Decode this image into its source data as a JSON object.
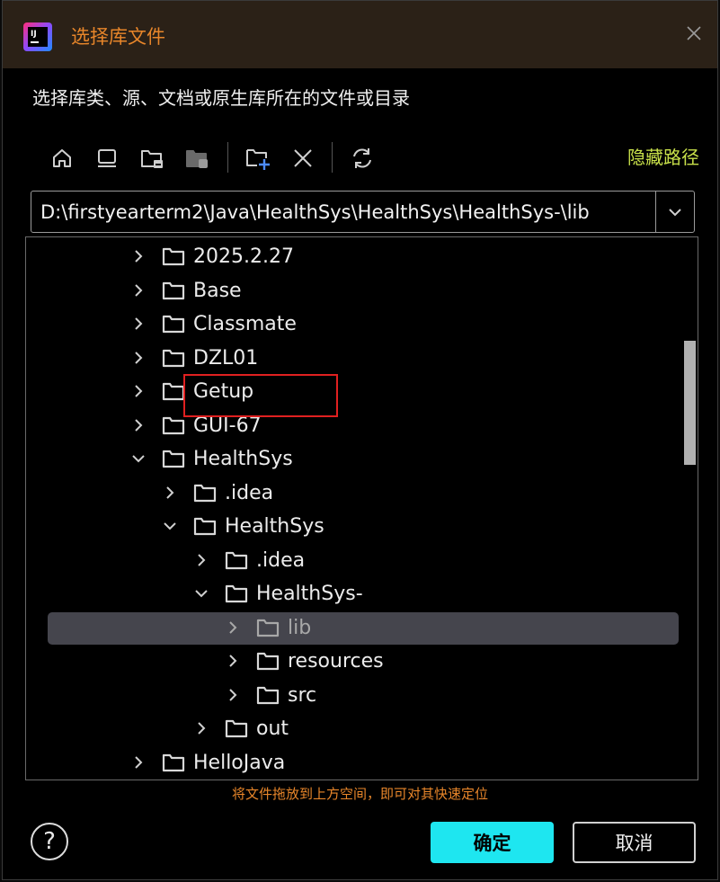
{
  "corner": {
    "text": "D:\\firstyearte"
  },
  "dialog": {
    "title": "选择库文件",
    "description": "选择库类、源、文档或原生库所在的文件或目录"
  },
  "toolbar": {
    "home_icon": "home-icon",
    "desktop_icon": "desktop-icon",
    "project_icon": "project-folder-icon",
    "module_icon": "module-folder-icon",
    "new_folder_icon": "new-folder-icon",
    "delete_icon": "delete-icon",
    "refresh_icon": "refresh-icon",
    "hide_path_label": "隐藏路径"
  },
  "path": {
    "value": "D:\\firstyearterm2\\Java\\HealthSys\\HealthSys\\HealthSys-\\lib"
  },
  "tree": {
    "items": [
      {
        "label": "2025.2.27",
        "expanded": false
      },
      {
        "label": "Base",
        "expanded": false
      },
      {
        "label": "Classmate",
        "expanded": false
      },
      {
        "label": "DZL01",
        "expanded": false
      },
      {
        "label": "Getup",
        "expanded": false
      },
      {
        "label": "GUI-67",
        "expanded": false
      },
      {
        "label": "HealthSys",
        "expanded": true
      },
      {
        "label": ".idea",
        "expanded": false
      },
      {
        "label": "HealthSys",
        "expanded": true
      },
      {
        "label": ".idea",
        "expanded": false
      },
      {
        "label": "HealthSys-",
        "expanded": true
      },
      {
        "label": "lib",
        "expanded": false,
        "selected": true
      },
      {
        "label": "resources",
        "expanded": false
      },
      {
        "label": "src",
        "expanded": false
      },
      {
        "label": "out",
        "expanded": false
      },
      {
        "label": "HelloJava",
        "expanded": false
      }
    ]
  },
  "hint": "将文件拖放到上方空间，即可对其快速定位",
  "buttons": {
    "help": "?",
    "ok": "确定",
    "cancel": "取消"
  },
  "colors": {
    "accent": "#1ee6f0",
    "title": "#e8862a",
    "hide_path": "#c8e04a",
    "highlight": "#e02020"
  }
}
